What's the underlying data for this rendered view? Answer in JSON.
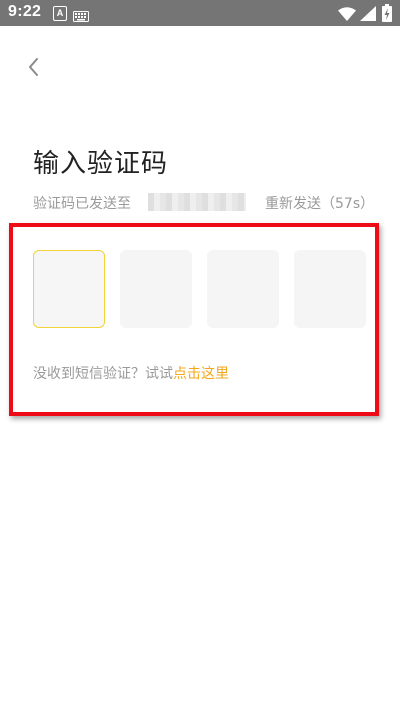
{
  "statusbar": {
    "time": "9:22",
    "notification_letter": "A",
    "icons": [
      "keyboard-icon",
      "wifi-icon",
      "signal-icon",
      "battery-charging-icon"
    ]
  },
  "header": {
    "back_icon": "chevron-left-icon"
  },
  "main": {
    "title": "输入验证码",
    "sent_label": "验证码已发送至",
    "resend_label": "重新发送（57s）",
    "code_boxes": [
      "",
      "",
      "",
      ""
    ],
    "help_text": "没收到短信验证？试试",
    "help_link": "点击这里"
  },
  "colors": {
    "statusbar_bg": "#757575",
    "active_box_border": "#f1d33b",
    "link": "#f2a81d",
    "annotation_outline": "#ee0a16"
  }
}
